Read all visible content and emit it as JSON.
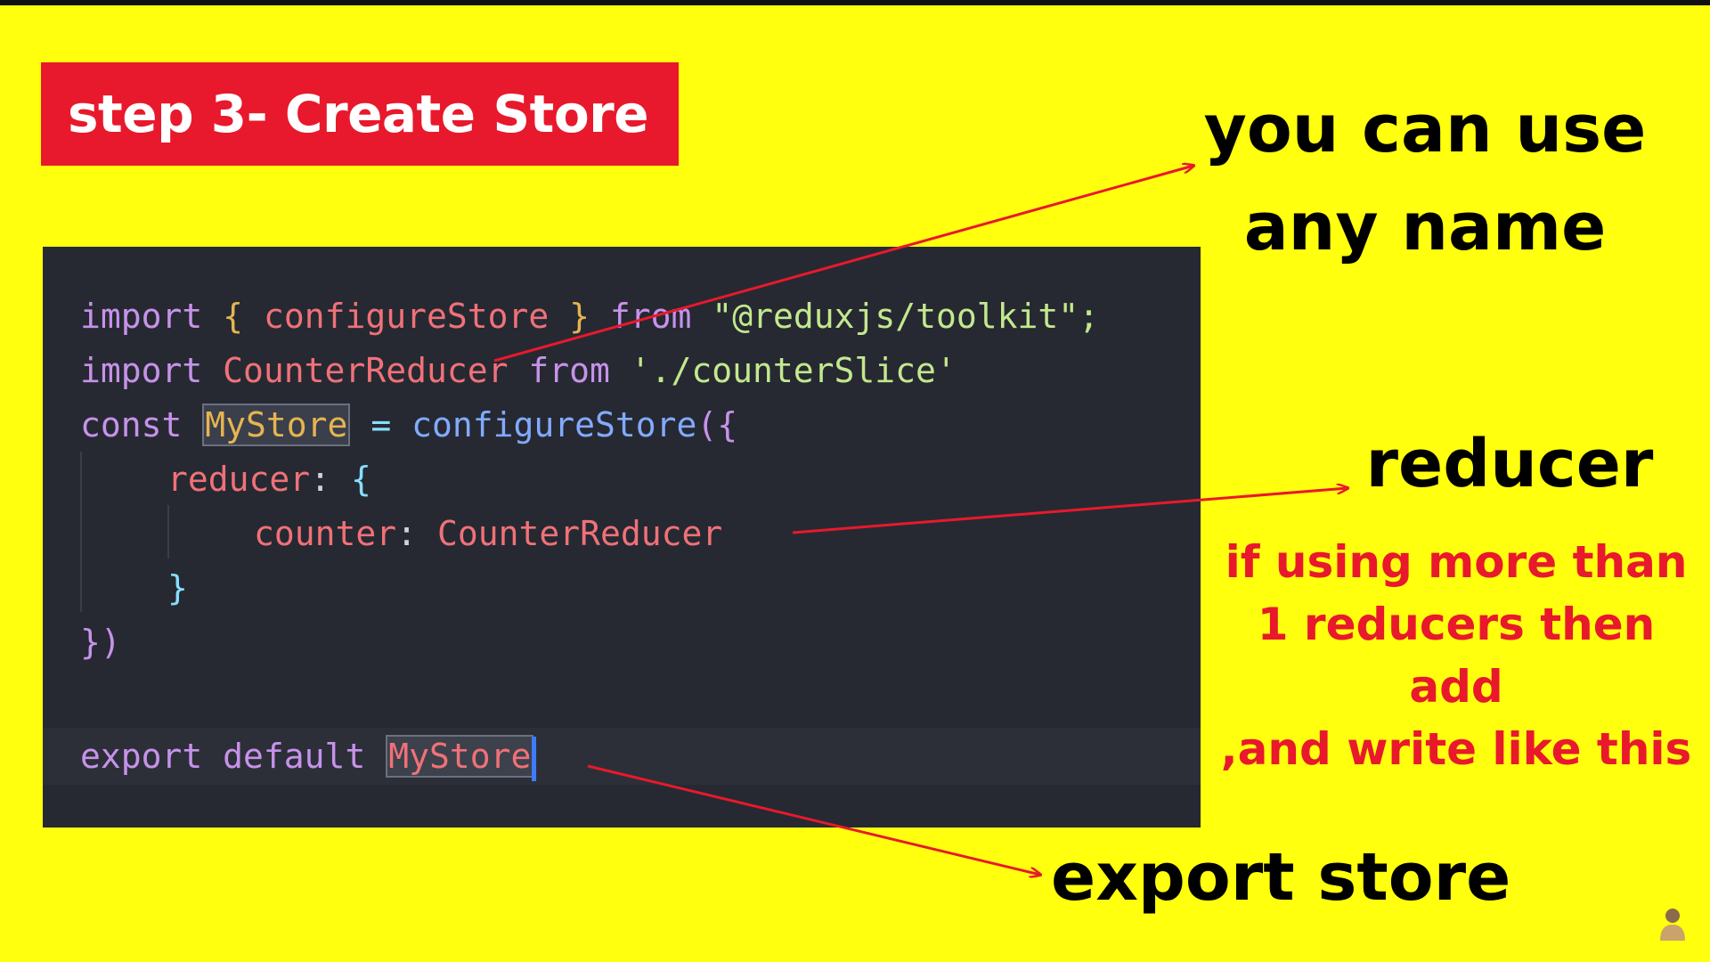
{
  "title": "step 3- Create Store",
  "code": {
    "line1": {
      "kw": "import",
      "lb": "{",
      "name": "configureStore",
      "rb": "}",
      "from": "from",
      "src": "\"@reduxjs/toolkit\";"
    },
    "line2": {
      "kw": "import",
      "name": "CounterReducer",
      "from": "from",
      "src": "'./counterSlice'"
    },
    "line3": {
      "kw": "const",
      "var": "MyStore",
      "eq": "=",
      "fn": "configureStore",
      "open": "({"
    },
    "line4": {
      "key": "reducer",
      "colon": ":",
      "open": "{"
    },
    "line5": {
      "key": "counter",
      "colon": ":",
      "val": "CounterReducer"
    },
    "line6": {
      "close": "}"
    },
    "line7": {
      "close": "})"
    },
    "line8": {
      "kw1": "export",
      "kw2": "default",
      "var": "MyStore"
    }
  },
  "annotations": {
    "any_name_1": "you can use",
    "any_name_2": "any name",
    "reducer": "reducer",
    "note_1": "if using more than",
    "note_2": "1 reducers then add",
    "note_3": ",and write like this",
    "export": "export store"
  },
  "colors": {
    "background": "#ffff0e",
    "banner": "#e8192c",
    "code_bg": "#262932",
    "arrow": "#e8192c"
  }
}
